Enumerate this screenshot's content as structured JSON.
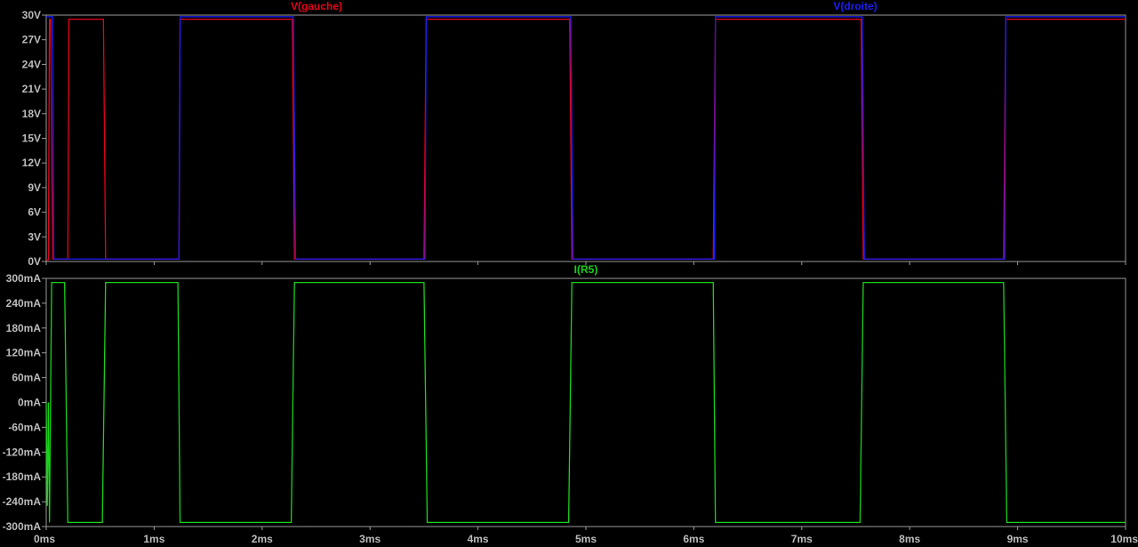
{
  "chart_data": [
    {
      "type": "line",
      "pane": "voltage",
      "title": "",
      "xlabel": "",
      "ylabel": "",
      "xlim": [
        0,
        10
      ],
      "ylim": [
        0,
        30
      ],
      "x_tick_labels": [
        "0ms",
        "1ms",
        "2ms",
        "3ms",
        "4ms",
        "5ms",
        "6ms",
        "7ms",
        "8ms",
        "9ms",
        "10ms"
      ],
      "y_ticks": [
        0,
        3,
        6,
        9,
        12,
        15,
        18,
        21,
        24,
        27,
        30
      ],
      "y_tick_labels": [
        "0V",
        "3V",
        "6V",
        "9V",
        "12V",
        "15V",
        "18V",
        "21V",
        "24V",
        "27V",
        "30V"
      ],
      "grid": false,
      "series": [
        {
          "name": "V(gauche)",
          "color": "#e8001c",
          "x": [
            0,
            0.02,
            0.03,
            0.04,
            0.06,
            0.07,
            0.2,
            0.21,
            0.53,
            0.55,
            1.23,
            1.24,
            2.28,
            2.3,
            3.5,
            3.52,
            4.85,
            4.87,
            6.18,
            6.2,
            7.55,
            7.57,
            8.87,
            8.89,
            10
          ],
          "y": [
            0.2,
            0.2,
            29.5,
            29.5,
            0.3,
            0.3,
            0.3,
            29.5,
            29.5,
            0.3,
            0.3,
            29.5,
            29.5,
            0.3,
            0.3,
            29.5,
            29.5,
            0.3,
            0.3,
            29.5,
            29.5,
            0.3,
            0.3,
            29.5,
            29.5
          ]
        },
        {
          "name": "V(droite)",
          "color": "#1c1cff",
          "x": [
            0,
            0.06,
            0.07,
            1.23,
            1.24,
            2.29,
            2.31,
            3.51,
            3.52,
            4.86,
            4.88,
            6.19,
            6.2,
            7.56,
            7.58,
            8.88,
            8.89,
            10
          ],
          "y": [
            29.8,
            29.8,
            0.3,
            0.3,
            29.8,
            29.8,
            0.3,
            0.3,
            29.8,
            29.8,
            0.3,
            0.3,
            29.8,
            29.8,
            0.3,
            0.3,
            29.8,
            29.8
          ]
        }
      ]
    },
    {
      "type": "line",
      "pane": "current",
      "title": "",
      "xlabel": "",
      "ylabel": "",
      "xlim": [
        0,
        10
      ],
      "ylim": [
        -300,
        300
      ],
      "x_tick_labels": [
        "0ms",
        "1ms",
        "2ms",
        "3ms",
        "4ms",
        "5ms",
        "6ms",
        "7ms",
        "8ms",
        "9ms",
        "10ms"
      ],
      "y_ticks": [
        300,
        240,
        180,
        120,
        60,
        0,
        -60,
        -120,
        -180,
        -240,
        -300
      ],
      "y_tick_labels": [
        "300mA",
        "240mA",
        "180mA",
        "120mA",
        "60mA",
        "0mA",
        "-60mA",
        "-120mA",
        "-180mA",
        "-240mA",
        "-300mA"
      ],
      "grid": false,
      "series": [
        {
          "name": "I(R5)",
          "color": "#19d219",
          "x": [
            0,
            0.01,
            0.02,
            0.03,
            0.04,
            0.05,
            0.06,
            0.17,
            0.2,
            0.52,
            0.55,
            1.22,
            1.24,
            2.27,
            2.3,
            3.5,
            3.53,
            4.84,
            4.87,
            6.18,
            6.2,
            7.54,
            7.57,
            8.87,
            8.9,
            10
          ],
          "y": [
            0,
            -250,
            0,
            -290,
            0,
            290,
            290,
            290,
            -290,
            -290,
            290,
            290,
            -290,
            -290,
            290,
            290,
            -290,
            -290,
            290,
            290,
            -290,
            -290,
            290,
            290,
            -290,
            -290
          ]
        }
      ]
    }
  ]
}
